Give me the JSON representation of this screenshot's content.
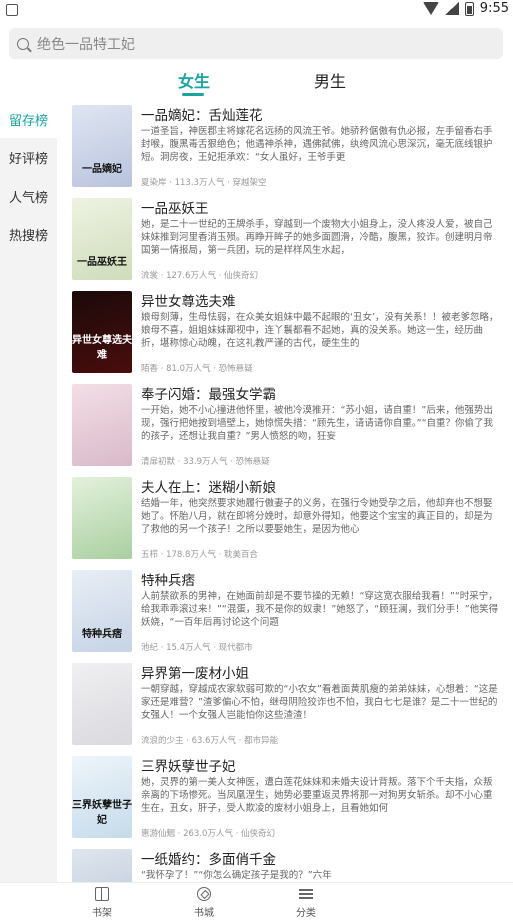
{
  "status": {
    "time": "9:55"
  },
  "search": {
    "placeholder": "绝色一品特工妃"
  },
  "top_tabs": [
    {
      "label": "女生",
      "active": true
    },
    {
      "label": "男生",
      "active": false
    }
  ],
  "sidebar": {
    "items": [
      {
        "label": "留存榜",
        "active": true
      },
      {
        "label": "好评榜",
        "active": false
      },
      {
        "label": "人气榜",
        "active": false
      },
      {
        "label": "热搜榜",
        "active": false
      }
    ]
  },
  "books": [
    {
      "title": "一品嫡妃：舌灿莲花",
      "desc": "一道圣旨，神医郡主将嫁花名远扬的风流王爷。她骄矜倨傲有仇必报，左手留香右手封喉，腹黑毒舌狠绝色；他遇神杀神，遇佛弑佛，纨绔风流心思深沉，毫无底线银护短。洞房夜，王妃拒承欢：“女人虽好，王爷手更",
      "meta": "夏染岸 · 113.3万人气 · 穿越架空",
      "cover_text": "一品嫡妃",
      "cover_colors": [
        "#dfe6f2",
        "#b9c3dd"
      ]
    },
    {
      "title": "一品巫妖王",
      "desc": "她，是二十一世纪的王牌杀手，穿越到一个废物大小姐身上，没人疼没人爱，被自己妹妹推到河里香消玉殒。再睁开眸子的她多面圆滑，冷酷，腹黑，狡诈。创建明月帝国第一情报局，第一兵团，玩的是样样风生水起，",
      "meta": "流裳 · 127.6万人气 · 仙侠奇幻",
      "cover_text": "一品巫妖王",
      "cover_colors": [
        "#eef3e2",
        "#cfdcbb"
      ]
    },
    {
      "title": "异世女尊选夫难",
      "desc": "娘母刻薄，生母怯弱，在众美女姐妹中最不起眼的‘丑女’，没有关系！！被老爹忽略，娘母不喜，姐姐妹妹鄙视中，连丫鬟都看不起她，真的没关系。她这一生，经历曲折，堪称惊心动魄，在这礼教严谨的古代，硬生生的",
      "meta": "陌香 · 81.0万人气 · 恐怖悬疑",
      "cover_text": "异世女尊选夫难",
      "cover_colors": [
        "#1a0a0a",
        "#4a0d0d"
      ],
      "cover_light": true
    },
    {
      "title": "奉子闪婚：最强女学霸",
      "desc": "一开始，她不小心撞进他怀里，被他冷漠推开：“苏小姐，请自重！”后来，他强势出现，强行把她按到墙壁上，她惊慌失措：“顾先生，请请请你自重。”“自重？你偷了我的孩子，还想让我自重？”男人愤怒的吻，狂妄",
      "meta": "清扉初默 · 33.9万人气 · 恐怖悬疑",
      "cover_text": "",
      "cover_colors": [
        "#f3dfe6",
        "#d9b9c9"
      ]
    },
    {
      "title": "夫人在上：迷糊小新娘",
      "desc": "结婚一年，他突然要求她履行傲妻子的义务，在强行令她受孕之后，他却弃也不想娶她了。怀胎八月，就在即将分娩时，却意外得知，他要这个宝宝的真正目的，却是为了救他的另一个孩子！之所以要娶她生，是因为他心",
      "meta": "五栉 · 178.8万人气 · 耽美百合",
      "cover_text": "",
      "cover_colors": [
        "#e4f1dd",
        "#a9cfa0"
      ]
    },
    {
      "title": "特种兵痞",
      "desc": "人前禁欲系的男神，在她面前却是不要节操的无赖！“穿这宽衣服给我看！”“时采宁，给我乖乖滚过来！”“混蛋，我不是你的奴隶！”她怒了，“顾狂澜，我们分手！”他笑得妖娆，“一百年后再讨论这个问题",
      "meta": "池纪 · 15.4万人气 · 现代都市",
      "cover_text": "特种兵痞",
      "cover_colors": [
        "#e9eef6",
        "#c5d3e4"
      ]
    },
    {
      "title": "异界第一废材小姐",
      "desc": "一朝穿越，穿越成农家软弱可欺的“小农女”看着面黄肌瘦的弟弟妹妹，心想着：“这是家还是难营？”渣爹偏心不怕，继母阴险狡诈也不怕，我白七七是谁？是二十一世纪的女强人！一个女强人岂能怕你这些渣渣！",
      "meta": "流浪的少主 · 63.6万人气 · 都市异能",
      "cover_text": "",
      "cover_colors": [
        "#f0f0f2",
        "#d9d9de"
      ]
    },
    {
      "title": "三界妖孽世子妃",
      "desc": "她，灵界的第一美人女神医，遭白莲花妹妹和未婚夫设计背叛。落下个千夫指，众叛亲离的下场惨死。当凤凰涅生，她势必要重返灵界将那一对狗男女斩杀。却不小心重生在，丑女，肝子，受人欺凌的废材小姐身上，且看她如何",
      "meta": "惠游仙魍 · 263.0万人气 · 仙侠奇幻",
      "cover_text": "三界妖孽世子妃",
      "cover_colors": [
        "#eef5fa",
        "#c5dbea"
      ]
    },
    {
      "title": "一纸婚约：多面俏千金",
      "desc": "“我怀孕了！”“你怎么确定孩子是我的？”六年",
      "meta": "",
      "cover_text": "",
      "cover_colors": [
        "#dfe6ee",
        "#b9c6d6"
      ]
    }
  ],
  "bottom_nav": [
    {
      "label": "书架",
      "icon": "book-icon"
    },
    {
      "label": "书城",
      "icon": "compass-icon"
    },
    {
      "label": "分类",
      "icon": "list-icon"
    }
  ],
  "colors": {
    "accent": "#1aa3a0",
    "sidebar_bg": "#f3f3f3"
  }
}
